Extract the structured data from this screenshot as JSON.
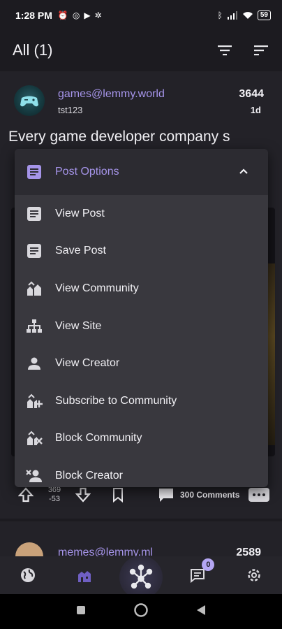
{
  "status_bar": {
    "time": "1:28 PM",
    "battery": "59"
  },
  "app_bar": {
    "title": "All (1)",
    "icons": [
      "filter-icon",
      "sort-icon"
    ]
  },
  "post": {
    "community": "games@lemmy.world",
    "author": "tst123",
    "score": "3644",
    "age": "1d",
    "title": "Every game developer company s",
    "votes_up": "369",
    "votes_down": "-53",
    "comments": "300 Comments"
  },
  "next_post": {
    "community": "memes@lemmy.ml",
    "score": "2589"
  },
  "post_options_menu": {
    "header": "Post Options",
    "items": [
      {
        "label": "View Post",
        "icon": "article-icon"
      },
      {
        "label": "Save Post",
        "icon": "article-icon"
      },
      {
        "label": "View Community",
        "icon": "community-icon"
      },
      {
        "label": "View Site",
        "icon": "sitemap-icon"
      },
      {
        "label": "View Creator",
        "icon": "person-icon"
      },
      {
        "label": "Subscribe to Community",
        "icon": "community-add-icon"
      },
      {
        "label": "Block Community",
        "icon": "community-block-icon"
      },
      {
        "label": "Block Creator",
        "icon": "person-block-icon"
      }
    ]
  },
  "bottom_nav": {
    "inbox_badge": "0",
    "items": [
      "globe-icon",
      "home-community-icon",
      "lemmy-logo",
      "inbox-icon",
      "settings-icon"
    ]
  },
  "colors": {
    "accent": "#a594e9",
    "background": "#1c1b20",
    "surface": "#39383e"
  }
}
